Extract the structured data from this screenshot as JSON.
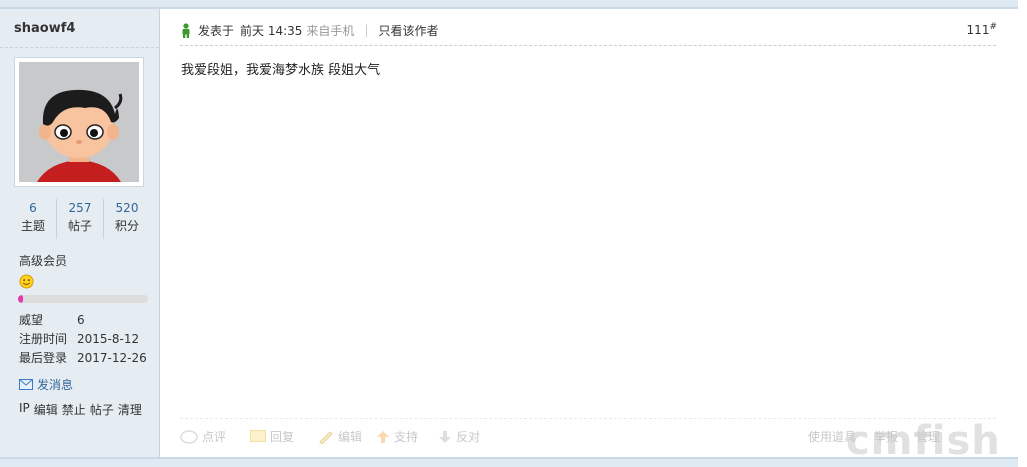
{
  "author": {
    "username": "shaowf4",
    "stats": [
      {
        "value": "6",
        "label": "主题"
      },
      {
        "value": "257",
        "label": "帖子"
      },
      {
        "value": "520",
        "label": "积分"
      }
    ],
    "level": "高级会员",
    "level_progress": 0.04,
    "info": [
      {
        "key": "威望",
        "value": "6"
      },
      {
        "key": "注册时间",
        "value": "2015-8-12"
      },
      {
        "key": "最后登录",
        "value": "2017-12-26"
      }
    ],
    "send_message": "发消息",
    "admin_links": [
      "IP",
      "编辑",
      "禁止",
      "帖子",
      "清理"
    ]
  },
  "post": {
    "posted_prefix": "发表于",
    "posted_time": "前天 14:35",
    "source": "来自手机",
    "author_only": "只看该作者",
    "floor": "111",
    "floor_mark": "#",
    "content": "我爱段姐，我爱海梦水族 段姐大气"
  },
  "actions": {
    "rate": "点评",
    "reply": "回复",
    "edit": "编辑",
    "support": "支持",
    "oppose": "反对",
    "use_tools": "使用道具",
    "report": "举报",
    "manage": "管理"
  },
  "watermark": "cmfish"
}
